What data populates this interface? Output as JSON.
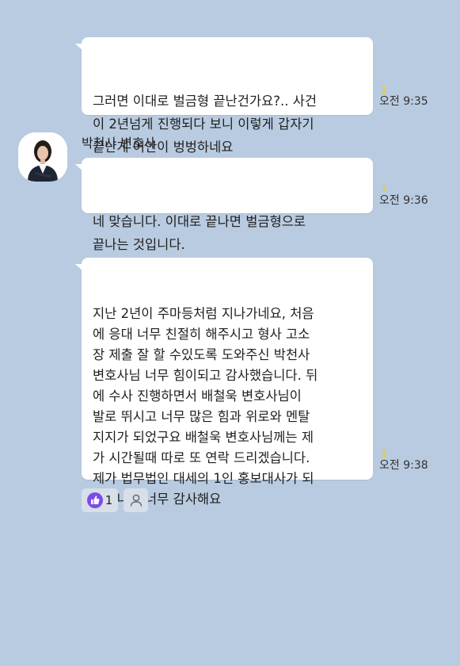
{
  "messages": [
    {
      "text": "그러면 이대로 벌금형 끝난건가요?.. 사건\n이 2년넘게 진행되다 보니 이렇게 갑자기\n끝난게 어안이 벙벙하네요",
      "time": "오전 9:35",
      "read": "1"
    },
    {
      "sender": "박천사 변호사",
      "text": "네 맞습니다. 이대로 끝나면 벌금형으로\n끝나는 것입니다.",
      "time": "오전 9:36",
      "read": "1"
    },
    {
      "text": "지난 2년이 주마등처럼 지나가네요, 처음\n에 응대 너무 친절히 해주시고 형사 고소\n장 제출 잘 할 수있도록 도와주신 박천사\n변호사님 너무 힘이되고 감사했습니다. 뒤\n에 수사 진행하면서 배철욱 변호사님이\n발로 뛰시고 너무 많은 힘과 위로와 멘탈\n지지가 되었구요 배철욱 변호사님께는 제\n가 시간될때 따로 또 연락 드리겠습니다.\n제가 법무법인 대세의 1인 홍보대사가 되\n겠습니다 너무 감사해요",
      "time": "오전 9:38",
      "read": "1"
    }
  ],
  "reactions": {
    "like_count": "1"
  },
  "colors": {
    "background": "#b9cbe0",
    "bubble": "#ffffff",
    "read_indicator": "#f0d000",
    "like": "#7d4ce8"
  }
}
